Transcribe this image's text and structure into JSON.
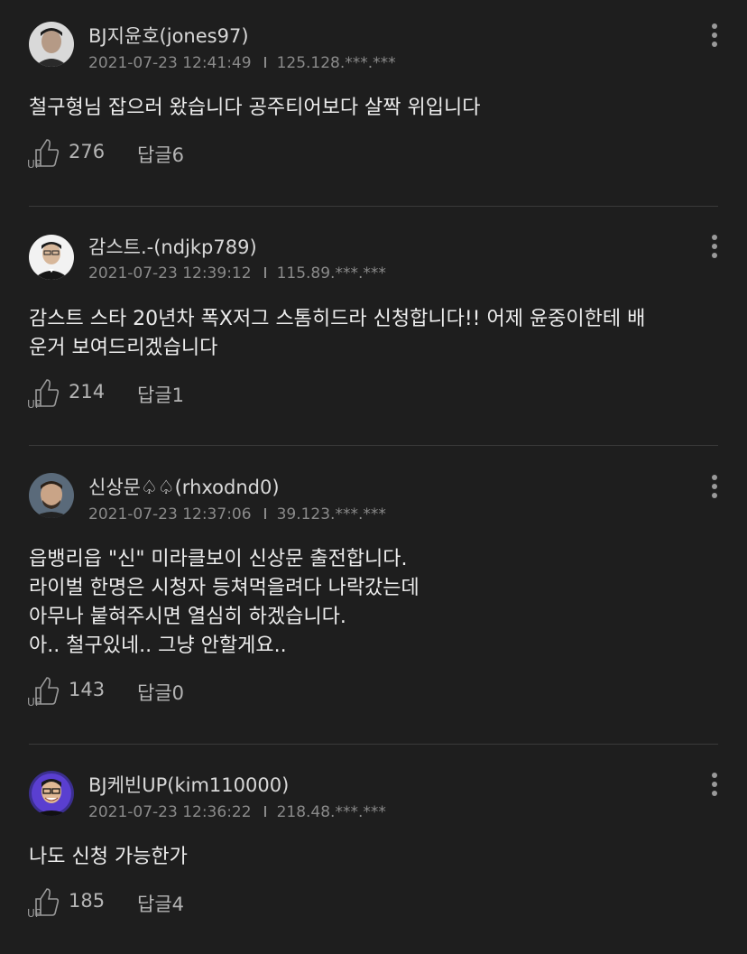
{
  "comments": [
    {
      "username": "BJ지윤호(jones97)",
      "date": "2021-07-23 12:41:49",
      "ip": "125.128.***.***",
      "lines": [
        "철구형님 잡으러 왔습니다 공주티어보다 살짝 위입니다"
      ],
      "likes": "276",
      "replies": "답글6"
    },
    {
      "username": "감스트.-(ndjkp789)",
      "date": "2021-07-23 12:39:12",
      "ip": "115.89.***.***",
      "lines": [
        "감스트 스타 20년차 폭X저그 스톰히드라 신청합니다!! 어제 윤중이한테 배",
        "운거 보여드리겠습니다"
      ],
      "likes": "214",
      "replies": "답글1"
    },
    {
      "username": "신상문♤♤(rhxodnd0)",
      "date": "2021-07-23 12:37:06",
      "ip": "39.123.***.***",
      "lines": [
        "읍뱅리읍 \"신\" 미라클보이 신상문 출전합니다.",
        "라이벌 한명은 시청자 등쳐먹을려다 나락갔는데",
        "아무나 붙혀주시면 열심히 하겠습니다.",
        "아.. 철구있네.. 그냥 안할게요.."
      ],
      "likes": "143",
      "replies": "답글0"
    },
    {
      "username": "BJ케빈UP(kim110000)",
      "date": "2021-07-23 12:36:22",
      "ip": "218.48.***.***",
      "lines": [
        "나도 신청 가능한가"
      ],
      "likes": "185",
      "replies": "답글4"
    }
  ]
}
